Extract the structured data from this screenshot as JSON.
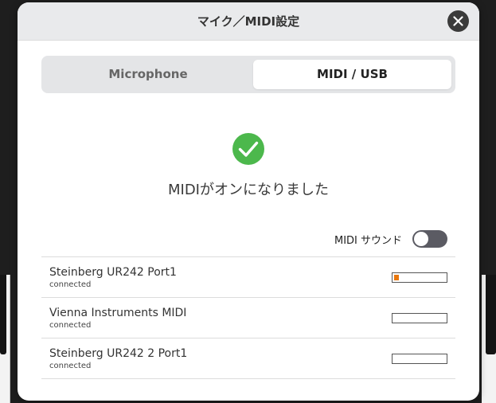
{
  "modal": {
    "title": "マイク／MIDI設定"
  },
  "tabs": [
    {
      "label": "Microphone",
      "active": false
    },
    {
      "label": "MIDI / USB",
      "active": true
    }
  ],
  "status": {
    "message": "MIDIがオンになりました",
    "icon": "check-circle-icon",
    "icon_color": "#4cb84c"
  },
  "midi_sound": {
    "label": "MIDI サウンド",
    "enabled": false
  },
  "devices": [
    {
      "name": "Steinberg UR242 Port1",
      "status": "connected",
      "level": 0.1
    },
    {
      "name": "Vienna Instruments MIDI",
      "status": "connected",
      "level": 0
    },
    {
      "name": "Steinberg UR242 2 Port1",
      "status": "connected",
      "level": 0
    }
  ],
  "colors": {
    "meter_fill": "#e8770e",
    "toggle_off": "#5b5b63"
  }
}
